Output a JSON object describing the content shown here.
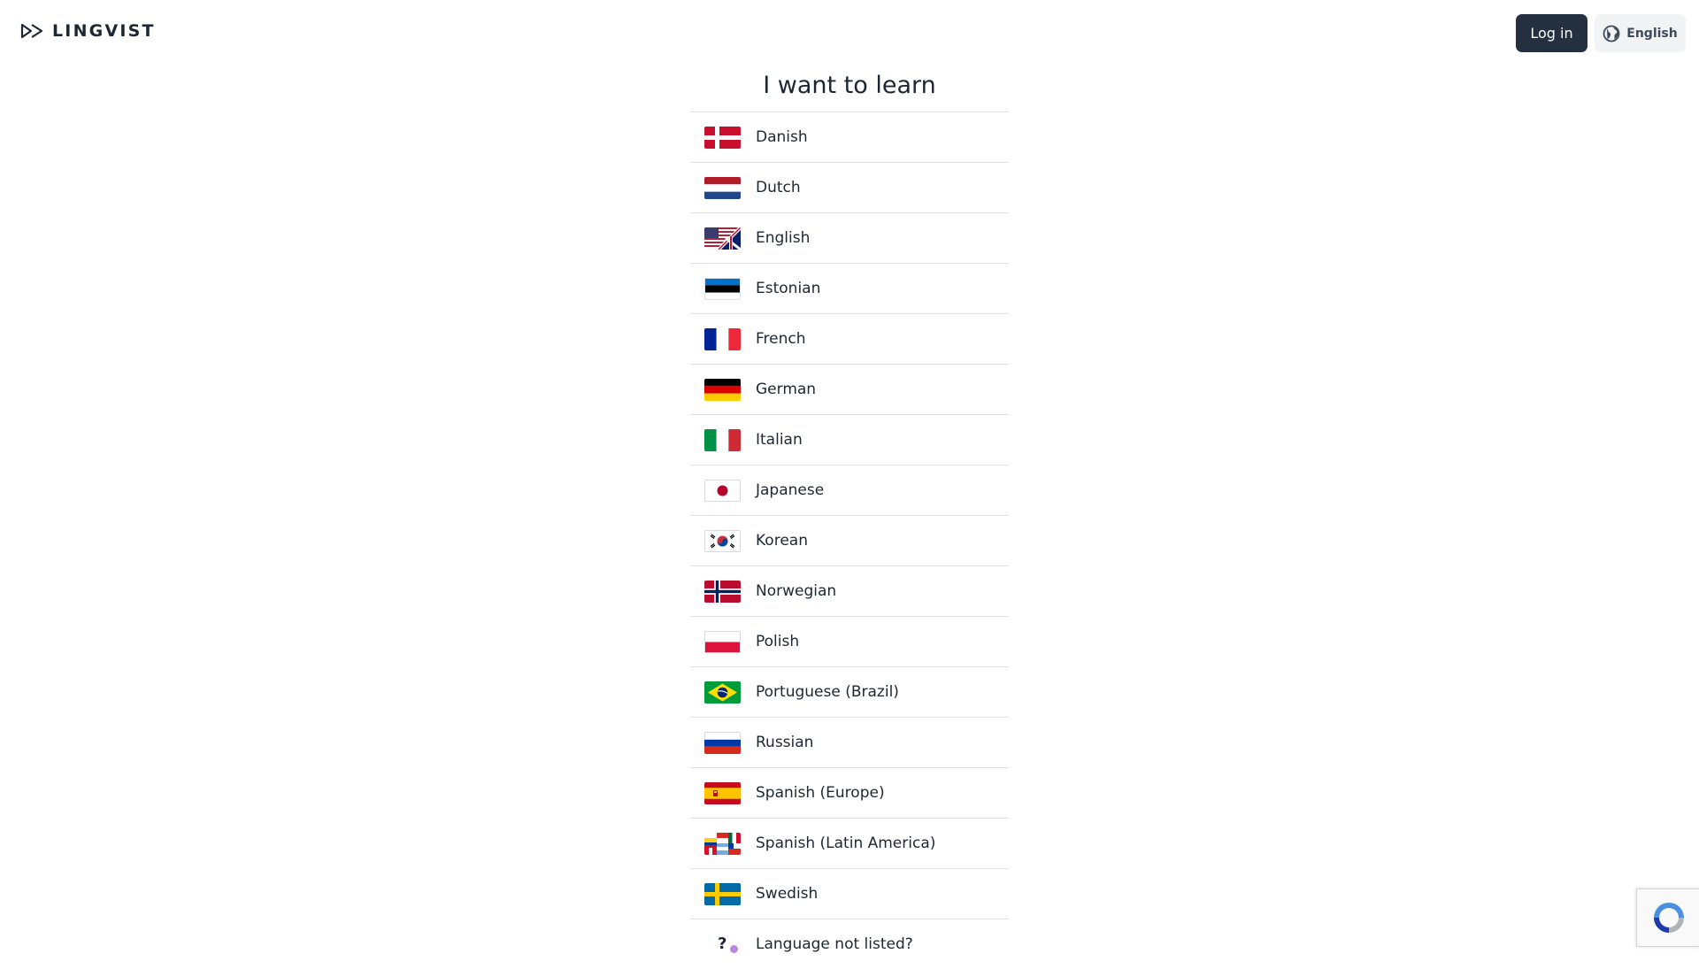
{
  "header": {
    "logo_text": "LINGVIST",
    "login_label": "Log in",
    "ui_language_label": "English"
  },
  "main": {
    "title": "I want to learn",
    "languages": [
      {
        "label": "Danish",
        "flag": "denmark-flag-icon"
      },
      {
        "label": "Dutch",
        "flag": "netherlands-flag-icon"
      },
      {
        "label": "English",
        "flag": "us-uk-flag-icon"
      },
      {
        "label": "Estonian",
        "flag": "estonia-flag-icon"
      },
      {
        "label": "French",
        "flag": "france-flag-icon"
      },
      {
        "label": "German",
        "flag": "germany-flag-icon"
      },
      {
        "label": "Italian",
        "flag": "italy-flag-icon"
      },
      {
        "label": "Japanese",
        "flag": "japan-flag-icon"
      },
      {
        "label": "Korean",
        "flag": "korea-flag-icon"
      },
      {
        "label": "Norwegian",
        "flag": "norway-flag-icon"
      },
      {
        "label": "Polish",
        "flag": "poland-flag-icon"
      },
      {
        "label": "Portuguese (Brazil)",
        "flag": "brazil-flag-icon"
      },
      {
        "label": "Russian",
        "flag": "russia-flag-icon"
      },
      {
        "label": "Spanish (Europe)",
        "flag": "spain-flag-icon"
      },
      {
        "label": "Spanish (Latin America)",
        "flag": "latin-america-flags-icon"
      },
      {
        "label": "Swedish",
        "flag": "sweden-flag-icon"
      }
    ],
    "not_listed_label": "Language not listed?"
  },
  "colors": {
    "login_button_bg": "#243040",
    "language_button_bg": "#f1f3f5",
    "divider": "#dfe3e8",
    "text": "#1d2733",
    "accent_dot": "#b886e3"
  }
}
